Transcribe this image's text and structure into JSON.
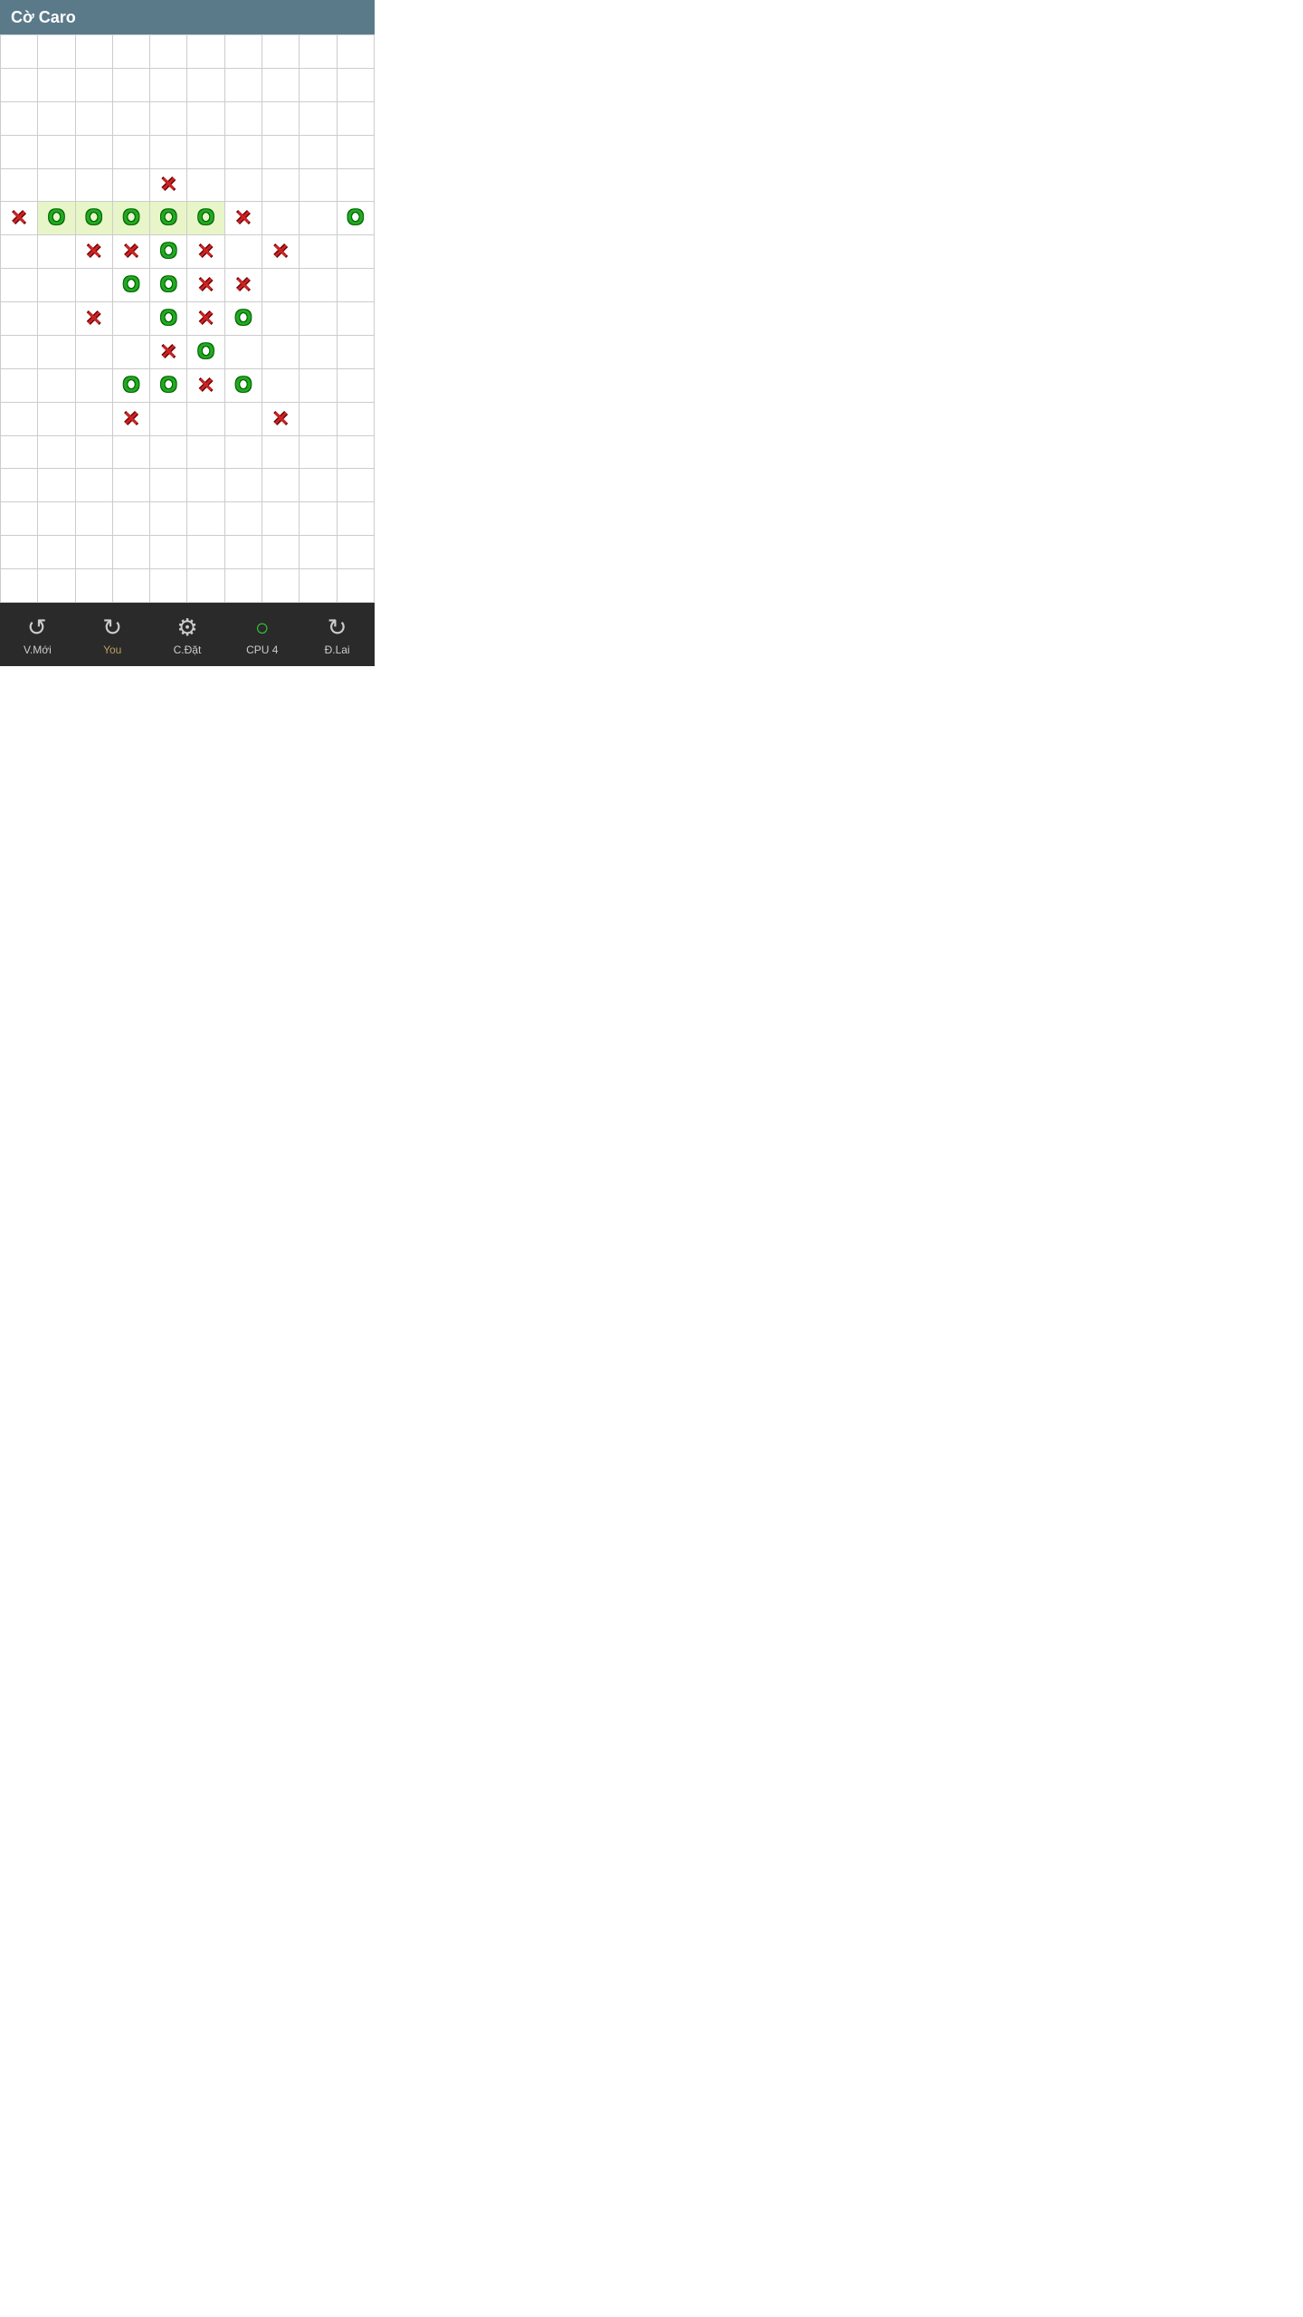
{
  "app": {
    "title": "Cờ Caro"
  },
  "toolbar": {
    "buttons": [
      {
        "id": "new-game",
        "icon": "undo",
        "label": "V.Mới",
        "active": false
      },
      {
        "id": "you",
        "icon": "arrow-left",
        "label": "You",
        "active": true
      },
      {
        "id": "settings",
        "icon": "gear",
        "label": "C.Đặt",
        "active": false
      },
      {
        "id": "cpu",
        "icon": "circle",
        "label": "CPU 4",
        "active": false
      },
      {
        "id": "undo",
        "icon": "redo",
        "label": "Đ.Lai",
        "active": false
      }
    ]
  },
  "board": {
    "cols": 10,
    "rows": 17,
    "cells": [
      {
        "row": 4,
        "col": 4,
        "piece": "x"
      },
      {
        "row": 5,
        "col": 0,
        "piece": "x"
      },
      {
        "row": 5,
        "col": 1,
        "piece": "o",
        "highlighted": true
      },
      {
        "row": 5,
        "col": 2,
        "piece": "o",
        "highlighted": true
      },
      {
        "row": 5,
        "col": 3,
        "piece": "o",
        "highlighted": true
      },
      {
        "row": 5,
        "col": 4,
        "piece": "o",
        "highlighted": true
      },
      {
        "row": 5,
        "col": 5,
        "piece": "o",
        "highlighted": true
      },
      {
        "row": 5,
        "col": 6,
        "piece": "x"
      },
      {
        "row": 5,
        "col": 9,
        "piece": "o"
      },
      {
        "row": 6,
        "col": 2,
        "piece": "x"
      },
      {
        "row": 6,
        "col": 3,
        "piece": "x"
      },
      {
        "row": 6,
        "col": 4,
        "piece": "o"
      },
      {
        "row": 6,
        "col": 5,
        "piece": "x"
      },
      {
        "row": 6,
        "col": 7,
        "piece": "x"
      },
      {
        "row": 7,
        "col": 3,
        "piece": "o"
      },
      {
        "row": 7,
        "col": 4,
        "piece": "o"
      },
      {
        "row": 7,
        "col": 5,
        "piece": "x"
      },
      {
        "row": 7,
        "col": 6,
        "piece": "x"
      },
      {
        "row": 8,
        "col": 2,
        "piece": "x"
      },
      {
        "row": 8,
        "col": 4,
        "piece": "o"
      },
      {
        "row": 8,
        "col": 5,
        "piece": "x"
      },
      {
        "row": 8,
        "col": 6,
        "piece": "o"
      },
      {
        "row": 9,
        "col": 4,
        "piece": "x"
      },
      {
        "row": 9,
        "col": 5,
        "piece": "o"
      },
      {
        "row": 10,
        "col": 3,
        "piece": "o"
      },
      {
        "row": 10,
        "col": 4,
        "piece": "o"
      },
      {
        "row": 10,
        "col": 5,
        "piece": "x"
      },
      {
        "row": 10,
        "col": 6,
        "piece": "o"
      },
      {
        "row": 11,
        "col": 3,
        "piece": "x"
      },
      {
        "row": 11,
        "col": 7,
        "piece": "x"
      }
    ]
  }
}
